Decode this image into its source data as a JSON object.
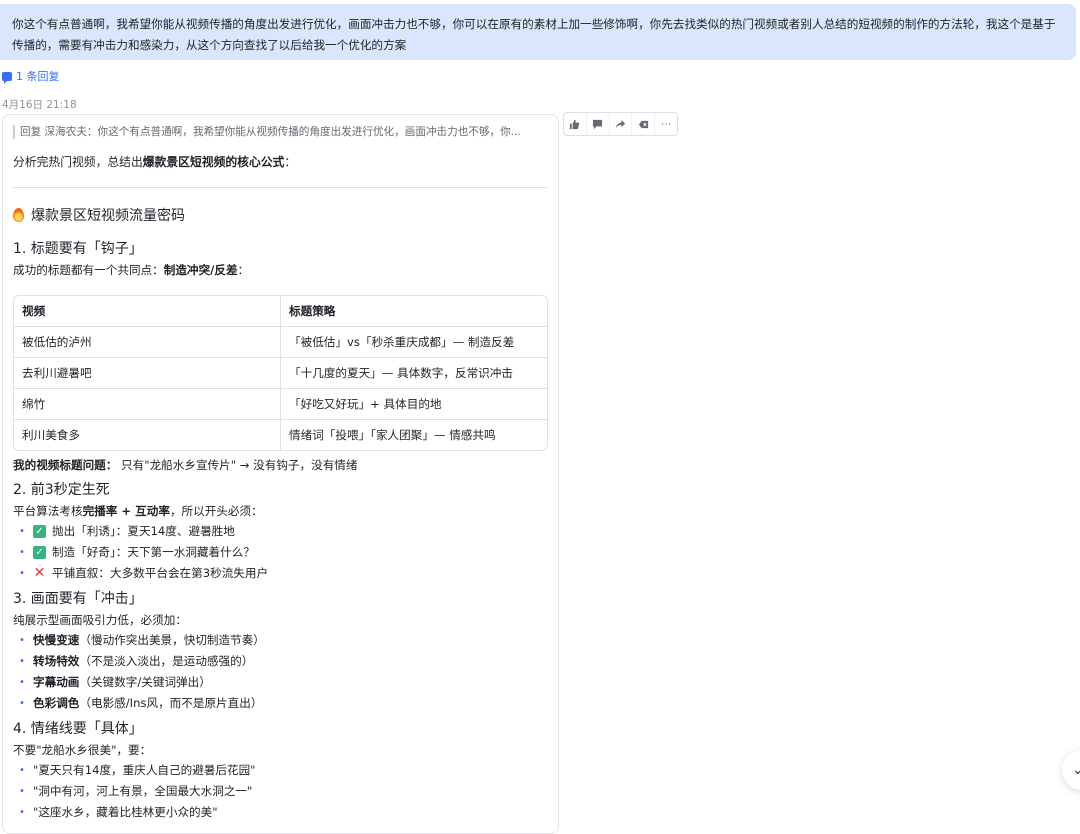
{
  "user_message": "你这个有点普通啊，我希望你能从视频传播的角度出发进行优化，画面冲击力也不够，你可以在原有的素材上加一些修饰啊，你先去找类似的热门视频或者别人总结的短视频的制作的方法轮，我这个是基于传播的，需要有冲击力和感染力，从这个方向查找了以后给我一个优化的方案",
  "reply_link": "1 条回复",
  "timestamp": "4月16日 21:18",
  "quote": "回复 深海农夫：你这个有点普通啊，我希望你能从视频传播的角度出发进行优化，画面冲击力也不够，你...",
  "intro": {
    "prefix": "分析完热门视频，总结出",
    "bold": "爆款景区短视频的核心公式",
    "suffix": "："
  },
  "section_title": "爆款景区短视频流量密码",
  "s1": {
    "heading": "1. 标题要有「钩子」",
    "sub_prefix": "成功的标题都有一个共同点：",
    "sub_bold": "制造冲突/反差",
    "sub_suffix": "：",
    "table": {
      "headers": [
        "视频",
        "标题策略"
      ],
      "rows": [
        [
          "被低估的泸州",
          "「被低估」vs「秒杀重庆成都」— 制造反差"
        ],
        [
          "去利川避暑吧",
          "「十几度的夏天」— 具体数字，反常识冲击"
        ],
        [
          "绵竹",
          "「好吃又好玩」+ 具体目的地"
        ],
        [
          "利川美食多",
          "情绪词「投喂」「家人团聚」— 情感共鸣"
        ]
      ]
    },
    "problem_bold": "我的视频标题问题：",
    "problem_text": " 只有\"龙船水乡宣传片\" → 没有钩子，没有情绪"
  },
  "s2": {
    "heading": "2. 前3秒定生死",
    "sub_prefix": "平台算法考核",
    "sub_bold": "完播率 + 互动率",
    "sub_suffix": "，所以开头必须：",
    "items": [
      {
        "icon": "check",
        "text": "抛出「利诱」：夏天14度、避暑胜地"
      },
      {
        "icon": "check",
        "text": "制造「好奇」：天下第一水洞藏着什么？"
      },
      {
        "icon": "cross",
        "text": "平铺直叙：大多数平台会在第3秒流失用户"
      }
    ]
  },
  "s3": {
    "heading": "3. 画面要有「冲击」",
    "sub": "纯展示型画面吸引力低，必须加：",
    "items": [
      {
        "bold": "快慢变速",
        "text": "（慢动作突出美景，快切制造节奏）"
      },
      {
        "bold": "转场特效",
        "text": "（不是淡入淡出，是运动感强的）"
      },
      {
        "bold": "字幕动画",
        "text": "（关键数字/关键词弹出）"
      },
      {
        "bold": "色彩调色",
        "text": "（电影感/Ins风，而不是原片直出）"
      }
    ]
  },
  "s4": {
    "heading": "4. 情绪线要「具体」",
    "sub": "不要\"龙船水乡很美\"，要：",
    "items": [
      "\"夏天只有14度，重庆人自己的避暑后花园\"",
      "\"洞中有河，河上有景，全国最大水洞之一\"",
      "\"这座水乡，藏着比桂林更小众的美\""
    ]
  },
  "actions": [
    "thumbs-up-icon",
    "comment-icon",
    "share-icon",
    "delete-icon",
    "more-icon"
  ],
  "colors": {
    "bubble": "#d9e6fb",
    "link": "#3370ff",
    "check": "#36b37e",
    "cross": "#e03b3b"
  }
}
